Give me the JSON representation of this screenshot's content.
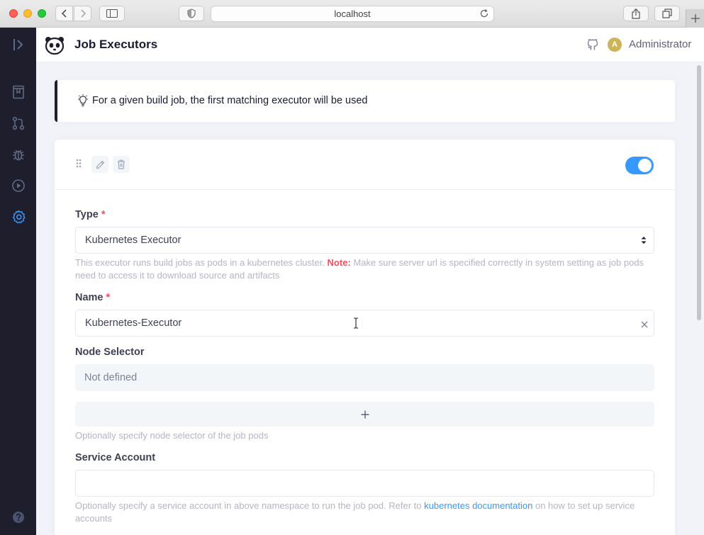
{
  "browser": {
    "url": "localhost"
  },
  "sidebar": {
    "items": [
      {
        "icon": "toggle-sidebar-icon"
      },
      {
        "icon": "projects-icon"
      },
      {
        "icon": "pull-requests-icon"
      },
      {
        "icon": "issues-icon"
      },
      {
        "icon": "builds-icon"
      },
      {
        "icon": "settings-icon",
        "active": true
      },
      {
        "icon": "help-icon"
      }
    ],
    "active_color": "#3699ff"
  },
  "header": {
    "title": "Job Executors",
    "avatar_initial": "A",
    "user_name": "Administrator"
  },
  "tip": {
    "text": "For a given build job, the first matching executor will be used"
  },
  "executor": {
    "enabled": true,
    "type": {
      "label": "Type",
      "required_mark": "*",
      "value": "Kubernetes Executor",
      "hint_prefix": "This executor runs build jobs as pods in a kubernetes cluster.",
      "hint_note": "Note:",
      "hint_suffix": "Make sure server url is specified correctly in system setting as job pods need to access it to download source and artifacts"
    },
    "name": {
      "label": "Name",
      "required_mark": "*",
      "value": "Kubernetes-Executor"
    },
    "node_selector": {
      "label": "Node Selector",
      "empty_text": "Not defined",
      "add_label": "+",
      "hint": "Optionally specify node selector of the job pods"
    },
    "service_account": {
      "label": "Service Account",
      "value": "",
      "hint_prefix": "Optionally specify a service account in above namespace to run the job pod. Refer to",
      "hint_link": "kubernetes documentation",
      "hint_suffix": "on how to set up service accounts"
    }
  }
}
